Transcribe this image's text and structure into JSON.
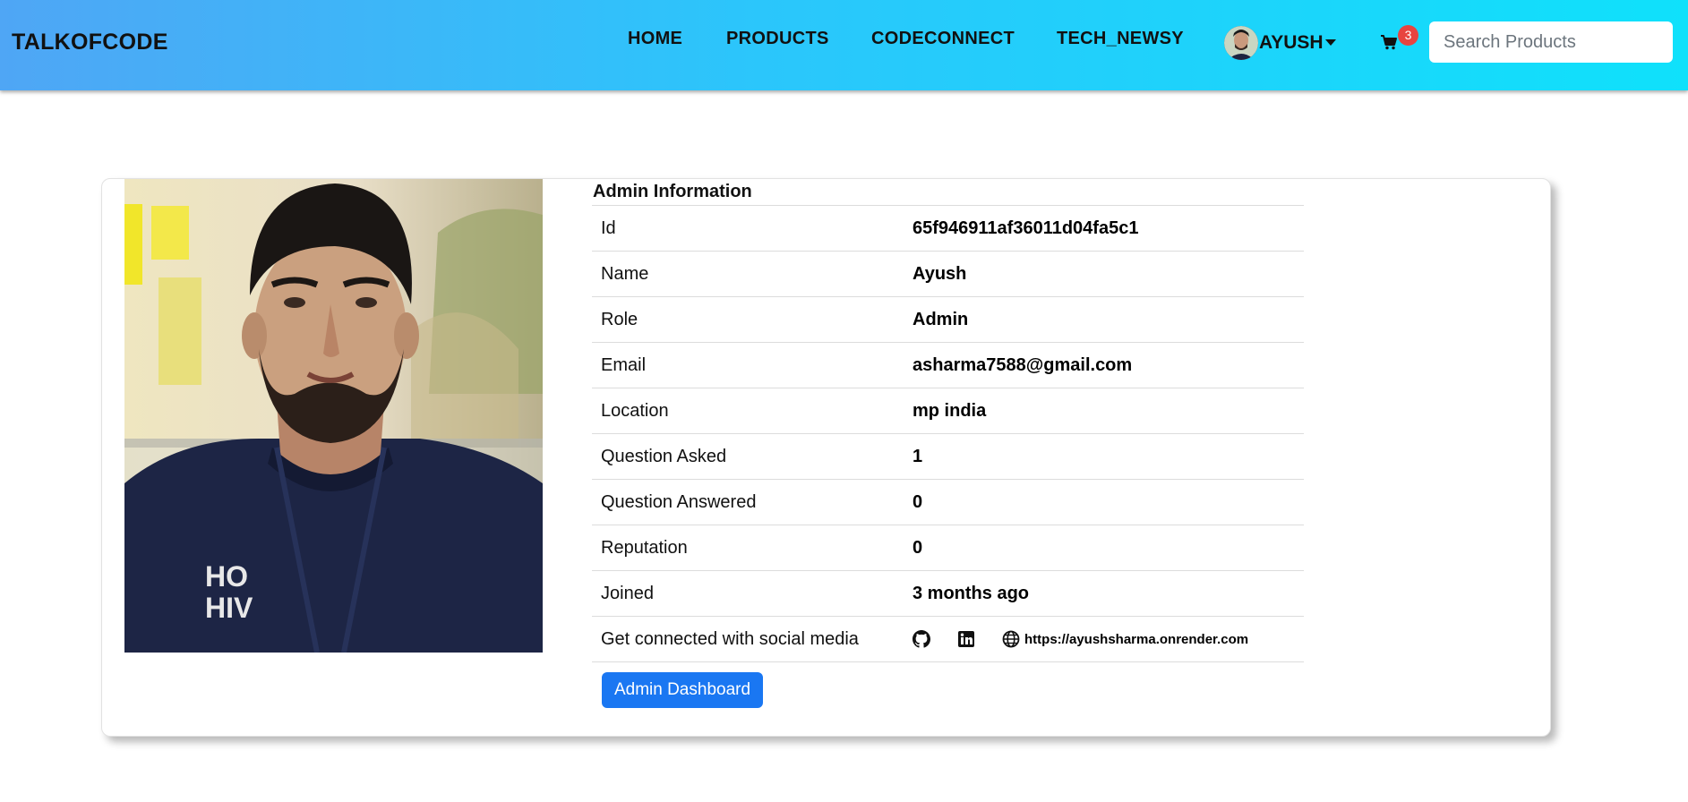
{
  "navbar": {
    "brand": "TALKOFCODE",
    "links": [
      {
        "label": "HOME"
      },
      {
        "label": "PRODUCTS"
      },
      {
        "label": "CODECONNECT"
      },
      {
        "label": "TECH_NEWSY"
      }
    ],
    "user_name": "AYUSH",
    "cart_count": "3",
    "search_placeholder": "Search Products",
    "search_value": ""
  },
  "profile": {
    "section_title": "Admin Information",
    "rows": [
      {
        "key": "Id",
        "value": "65f946911af36011d04fa5c1"
      },
      {
        "key": "Name",
        "value": "Ayush"
      },
      {
        "key": "Role",
        "value": "Admin"
      },
      {
        "key": "Email",
        "value": "asharma7588@gmail.com"
      },
      {
        "key": "Location",
        "value": "mp india"
      },
      {
        "key": "Question Asked",
        "value": "1"
      },
      {
        "key": "Question Answered",
        "value": "0"
      },
      {
        "key": "Reputation",
        "value": "0"
      },
      {
        "key": "Joined",
        "value": "3 months ago"
      }
    ],
    "social_label": "Get connected with social media",
    "social_icons": [
      "github-icon",
      "linkedin-icon",
      "globe-icon"
    ],
    "website": "https://ayushsharma.onrender.com",
    "dashboard_button": "Admin Dashboard"
  },
  "colors": {
    "navbar_gradient_start": "#4fa6f5",
    "navbar_gradient_end": "#0fe1fb",
    "primary_button": "#1a77f2",
    "badge": "#e8443f"
  }
}
